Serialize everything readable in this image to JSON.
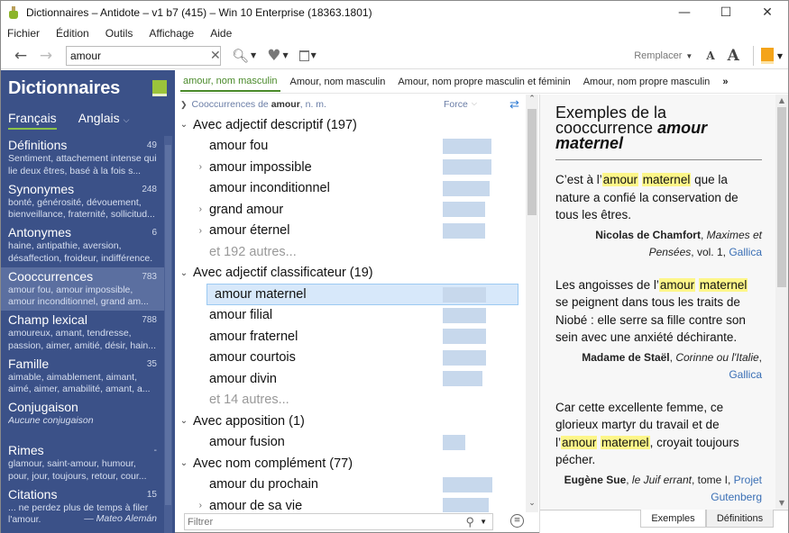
{
  "window": {
    "title": "Dictionnaires – Antidote – v1 b7 (415) – Win 10 Enterprise (18363.1801)",
    "controls": [
      "minimize",
      "maximize",
      "close"
    ]
  },
  "menu": [
    "Fichier",
    "Édition",
    "Outils",
    "Affichage",
    "Aide"
  ],
  "toolbar": {
    "search_value": "amour",
    "replace_label": "Remplacer",
    "font_small": "A",
    "font_large": "A"
  },
  "sidebar": {
    "title": "Dictionnaires",
    "languages": [
      {
        "label": "Français",
        "active": true
      },
      {
        "label": "Anglais",
        "active": false
      }
    ],
    "items": [
      {
        "name": "Définitions",
        "count": "49",
        "desc": "Sentiment, attachement intense qui lie deux êtres, basé à la fois s..."
      },
      {
        "name": "Synonymes",
        "count": "248",
        "desc": "bonté, générosité, dévouement, bienveillance, fraternité, sollicitud..."
      },
      {
        "name": "Antonymes",
        "count": "6",
        "desc": "haine, antipathie, aversion, désaffection, froideur, indifférence."
      },
      {
        "name": "Cooccurrences",
        "count": "783",
        "desc": "amour fou, amour impossible, amour inconditionnel, grand am...",
        "active": true
      },
      {
        "name": "Champ lexical",
        "count": "788",
        "desc": "amoureux, amant, tendresse, passion, aimer, amitié, désir, hain..."
      },
      {
        "name": "Famille",
        "count": "35",
        "desc": "aimable, aimablement, aimant, aimé, aimer, amabilité, amant, a..."
      },
      {
        "name": "Conjugaison",
        "count": "",
        "desc": "Aucune conjugaison"
      },
      {
        "name": "Rimes",
        "count": "-",
        "desc": "glamour, saint-amour, humour, pour, jour, toujours, retour, cour..."
      },
      {
        "name": "Citations",
        "count": "15",
        "desc": "... ne perdez plus de temps à filer l'amour.",
        "author": "— Mateo Alemán"
      }
    ]
  },
  "entry_tabs": [
    {
      "label": "amour, nom masculin",
      "active": true
    },
    {
      "label": "Amour, nom masculin"
    },
    {
      "label": "Amour, nom propre masculin et féminin"
    },
    {
      "label": "Amour, nom propre masculin"
    },
    {
      "label": "»"
    }
  ],
  "cooc": {
    "header_prefix": "Cooccurrences de ",
    "header_word": "amour",
    "header_suffix": ", n. m.",
    "force_label": "Force",
    "groups": [
      {
        "title": "Avec adjectif descriptif (197)",
        "rows": [
          {
            "text": "amour fou",
            "expandable": false,
            "strength": 0.95
          },
          {
            "text": "amour impossible",
            "expandable": true,
            "strength": 0.94
          },
          {
            "text": "amour inconditionnel",
            "expandable": false,
            "strength": 0.91
          },
          {
            "text": "grand amour",
            "expandable": true,
            "strength": 0.83
          },
          {
            "text": "amour éternel",
            "expandable": true,
            "strength": 0.83
          }
        ],
        "more": "et 192 autres..."
      },
      {
        "title": "Avec adjectif classificateur (19)",
        "rows": [
          {
            "text": "amour maternel",
            "expandable": false,
            "strength": 0.85,
            "selected": true
          },
          {
            "text": "amour filial",
            "expandable": false,
            "strength": 0.85
          },
          {
            "text": "amour fraternel",
            "expandable": false,
            "strength": 0.85
          },
          {
            "text": "amour courtois",
            "expandable": false,
            "strength": 0.85
          },
          {
            "text": "amour divin",
            "expandable": false,
            "strength": 0.77
          }
        ],
        "more": "et 14 autres..."
      },
      {
        "title": "Avec apposition (1)",
        "rows": [
          {
            "text": "amour fusion",
            "expandable": false,
            "strength": 0.44
          }
        ]
      },
      {
        "title": "Avec nom complément (77)",
        "rows": [
          {
            "text": "amour du prochain",
            "expandable": false,
            "strength": 0.97
          },
          {
            "text": "amour de sa vie",
            "expandable": true,
            "strength": 0.89
          }
        ]
      }
    ],
    "filter_placeholder": "Filtrer"
  },
  "examples": {
    "heading": "Exemples de la cooccurrence ",
    "heading_term": "amour maternel",
    "items": [
      {
        "before": "C’est à l’",
        "w1": "amour",
        "w2": "maternel",
        "after": " que la nature a confié la conservation de tous les êtres.",
        "author": "Nicolas de Chamfort",
        "work": "Maximes et Pensées",
        "detail": ", vol. 1, ",
        "source": "Gallica"
      },
      {
        "before": "Les angoisses de l’",
        "w1": "amour",
        "w2": "maternel",
        "after": " se peignent dans tous les traits de Niobé : elle serre sa fille contre son sein avec une anxiété déchirante.",
        "author": "Madame de Staël",
        "work": "Corinne ou l'Italie",
        "detail": ", ",
        "source": "Gallica"
      },
      {
        "before": "Car cette excellente femme, ce glorieux martyr du travail et de l’",
        "w1": "amour",
        "w2": "maternel",
        "after": ", croyait toujours pécher.",
        "author": "Eugène Sue",
        "work": "le Juif errant",
        "detail": ", tome I, ",
        "source": "Projet Gutenberg"
      }
    ]
  },
  "bottom_tabs": [
    {
      "label": "Exemples",
      "active": true
    },
    {
      "label": "Définitions"
    }
  ]
}
